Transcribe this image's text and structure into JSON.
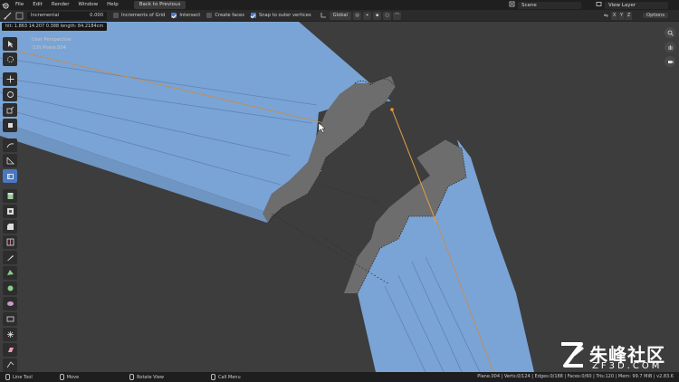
{
  "menubar": {
    "items": [
      "File",
      "Edit",
      "Render",
      "Window",
      "Help"
    ],
    "back_button": "Back to Previous",
    "scene_label": "Scene",
    "view_layer_label": "View Layer"
  },
  "toolheader": {
    "snap_mode": "Incremental",
    "snap_value": "0.000",
    "increments_of_grid_label": "Increments of Grid",
    "intersect_label": "Intersect",
    "create_faces_label": "Create faces",
    "snap_outer_label": "Snap to outer vertices",
    "orientation": "Global",
    "axes": [
      "X",
      "Y",
      "Z"
    ],
    "options_label": "Options",
    "checks": {
      "increments_of_grid": false,
      "intersect": true,
      "create_faces": false,
      "snap_outer": true
    }
  },
  "viewport": {
    "hud_text": "hit: 1.863 14.207 0.388 length: 84.2184cm",
    "perspective_label": "User Perspective",
    "object_label": "(10) Plane.004"
  },
  "statusbar": {
    "left_items": [
      "Line Tool",
      "Move",
      "Rotate View",
      "Call Menu"
    ],
    "stats": "Plane.004 | Verts:0/124 | Edges:0/188 | Faces:0/60 | Tris:120 | Mem: 99.7 MiB | v2.83.6"
  },
  "watermark": {
    "chinese": "朱峰社区",
    "site": "ZF3D.COM"
  },
  "colors": {
    "mesh_blue": "#7aa4d6",
    "face_gray": "#6e6e6e",
    "line_orange": "#e8a040",
    "accent": "#4a7cc9"
  }
}
